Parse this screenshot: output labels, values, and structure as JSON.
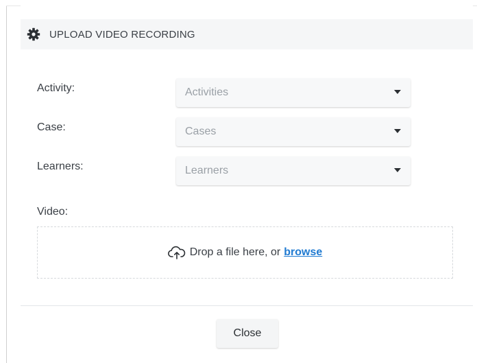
{
  "modal": {
    "title": "UPLOAD VIDEO RECORDING",
    "header_icon": "gear-icon"
  },
  "form": {
    "activity": {
      "label": "Activity:",
      "value": "Activities"
    },
    "case": {
      "label": "Case:",
      "value": "Cases"
    },
    "learners": {
      "label": "Learners:",
      "value": "Learners"
    },
    "video": {
      "label": "Video:",
      "drop_text": "Drop a file here, or",
      "browse_label": "browse",
      "icon": "cloud-upload-icon"
    }
  },
  "footer": {
    "close_label": "Close"
  },
  "colors": {
    "header_bg": "#f5f6f7",
    "link": "#1f7ad1",
    "text": "#3a3f45",
    "placeholder": "#9aa0a6"
  }
}
